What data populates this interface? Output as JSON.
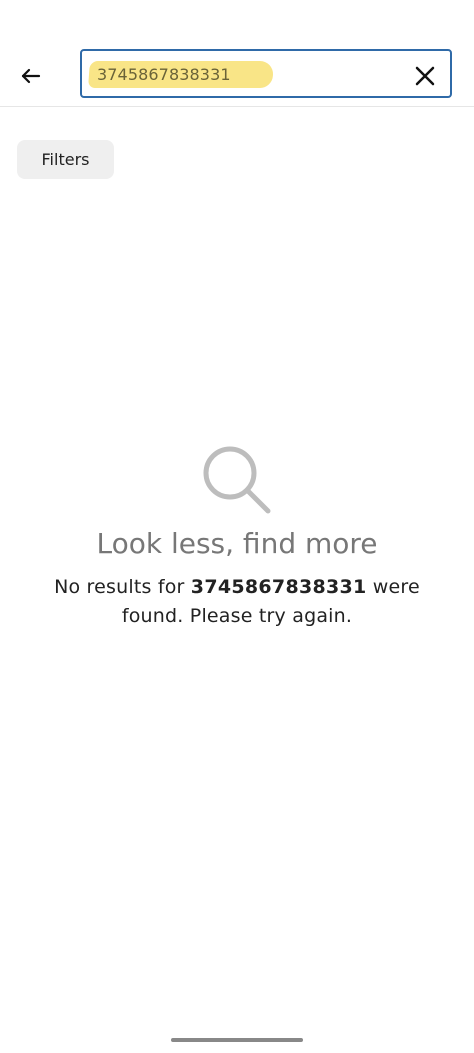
{
  "search": {
    "query": "3745867838331",
    "clear_icon": "close-icon",
    "back_icon": "arrow-left-icon",
    "accent_color": "#2f6aa8",
    "highlight_color": "#f8e27a"
  },
  "filters": {
    "label": "Filters"
  },
  "empty_state": {
    "icon": "search-icon",
    "title": "Look less, find more",
    "message_prefix": "No results for ",
    "message_query": "3745867838331",
    "message_suffix": " were found. Please try again."
  }
}
